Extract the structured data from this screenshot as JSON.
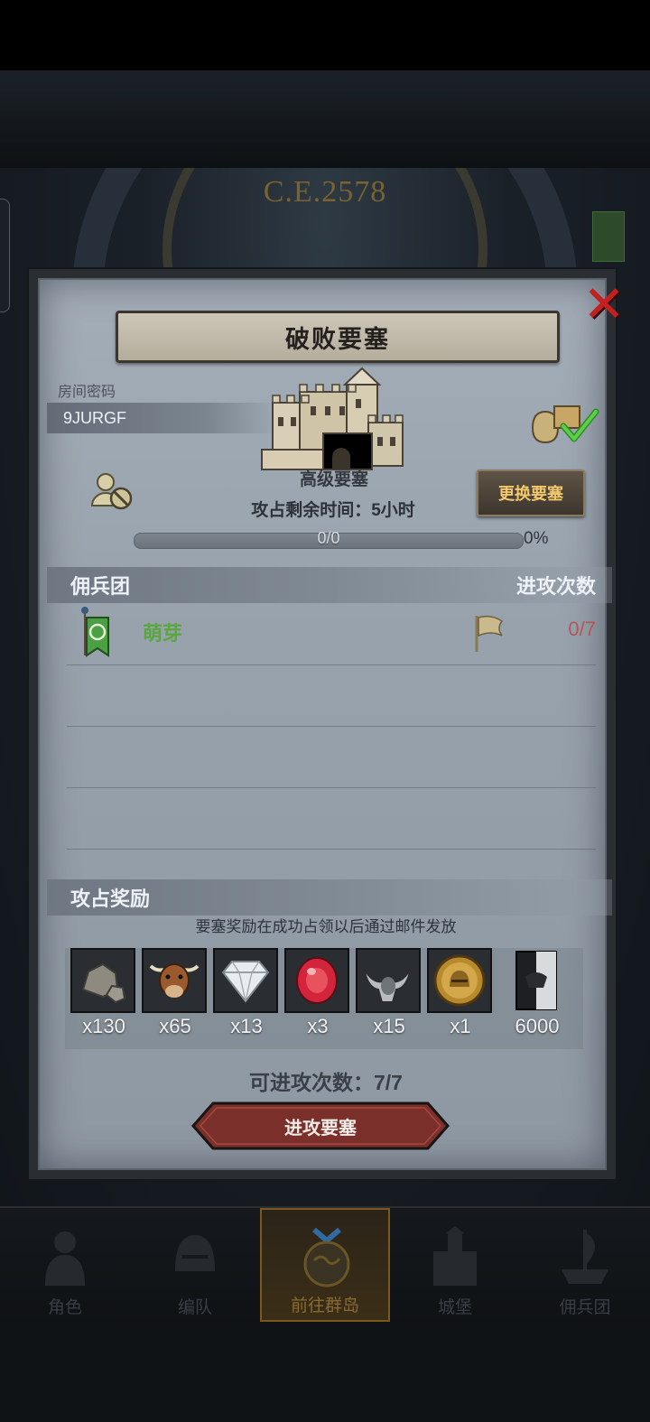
{
  "scene": {
    "year": "C.E.2578"
  },
  "panel": {
    "title": "破败要塞",
    "room_label": "房间密码",
    "room_code": "9JURGF",
    "fortress_name": "高级要塞",
    "time_left": "攻占剩余时间：5小时",
    "change_button": "更换要塞",
    "progress": {
      "text": "0/0",
      "percent_label": "0%",
      "value": 0
    }
  },
  "mercenary": {
    "header_left": "佣兵团",
    "header_right": "进攻次数",
    "rows": [
      {
        "name": "萌芽",
        "attacks": "0/7"
      }
    ]
  },
  "rewards": {
    "header": "攻占奖励",
    "note": "要塞奖励在成功占领以后通过邮件发放",
    "items": [
      {
        "icon": "stone-icon",
        "qty": "x130"
      },
      {
        "icon": "cow-icon",
        "qty": "x65"
      },
      {
        "icon": "diamond-icon",
        "qty": "x13"
      },
      {
        "icon": "ruby-icon",
        "qty": "x3"
      },
      {
        "icon": "horn-icon",
        "qty": "x15"
      },
      {
        "icon": "helmet-coin-icon",
        "qty": "x1"
      },
      {
        "icon": "banner-icon",
        "qty": "6000"
      }
    ],
    "available": "可进攻次数：7/7",
    "attack_button": "进攻要塞"
  },
  "nav": [
    {
      "label": "角色"
    },
    {
      "label": "编队"
    },
    {
      "label": "前往群岛"
    },
    {
      "label": "城堡"
    },
    {
      "label": "佣兵团"
    }
  ],
  "colors": {
    "guild_name": "#58a83d",
    "attack_count": "#b25656",
    "change_button_text": "#f3c86c",
    "attack_button": "#7a2f2a"
  }
}
